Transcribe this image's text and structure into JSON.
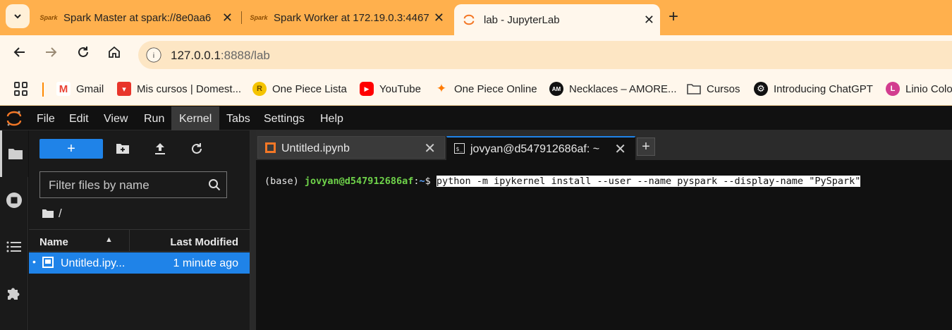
{
  "browser": {
    "tabs": [
      {
        "title": "Spark Master at spark://8e0aa6",
        "favicon": "spark-icon",
        "active": false
      },
      {
        "title": "Spark Worker at 172.19.0.3:4467",
        "favicon": "spark-icon",
        "active": false
      },
      {
        "title": "lab - JupyterLab",
        "favicon": "jupyter-icon",
        "active": true
      }
    ],
    "address": {
      "host": "127.0.0.1",
      "path": ":8888/lab"
    },
    "bookmarks": [
      {
        "label": "Gmail",
        "icon": "gmail-icon",
        "color": "#ea4335",
        "glyph": "M"
      },
      {
        "label": "Mis cursos | Domest...",
        "icon": "domestika-icon",
        "color": "#e8352a",
        "glyph": "▾"
      },
      {
        "label": "One Piece Lista",
        "icon": "one-piece-lista-icon",
        "color": "#f0b400",
        "glyph": "R"
      },
      {
        "label": "YouTube",
        "icon": "youtube-icon",
        "color": "#ff0000",
        "glyph": "▶"
      },
      {
        "label": "One Piece Online",
        "icon": "one-piece-online-icon",
        "color": "#ff7a00",
        "glyph": "✦"
      },
      {
        "label": "Necklaces – AMORE...",
        "icon": "amore-icon",
        "color": "#111111",
        "glyph": "AM"
      },
      {
        "label": "Cursos",
        "icon": "folder-icon",
        "color": "#555555",
        "glyph": ""
      },
      {
        "label": "Introducing ChatGPT",
        "icon": "chatgpt-icon",
        "color": "#111111",
        "glyph": "⚙"
      },
      {
        "label": "Linio Colo",
        "icon": "linio-icon",
        "color": "#d23d8f",
        "glyph": "L"
      }
    ]
  },
  "jupyter": {
    "menu": [
      "File",
      "Edit",
      "View",
      "Run",
      "Kernel",
      "Tabs",
      "Settings",
      "Help"
    ],
    "active_menu": "Kernel",
    "filebrowser": {
      "new_label": "+",
      "filter_placeholder": "Filter files by name",
      "breadcrumb": "/",
      "columns": {
        "name": "Name",
        "modified": "Last Modified"
      },
      "files": [
        {
          "name": "Untitled.ipy...",
          "modified": "1 minute ago",
          "selected": true
        }
      ]
    },
    "dock_tabs": [
      {
        "label": "Untitled.ipynb",
        "icon": "notebook-icon",
        "active": false
      },
      {
        "label": "jovyan@d547912686af: ~",
        "icon": "terminal-icon",
        "active": true
      }
    ],
    "terminal": {
      "env": "(base) ",
      "user_host": "jovyan@d547912686af",
      "sep": ":",
      "path": "~",
      "prompt": "$ ",
      "command": "python -m ipykernel install --user --name pyspark --display-name \"PySpark\""
    }
  }
}
